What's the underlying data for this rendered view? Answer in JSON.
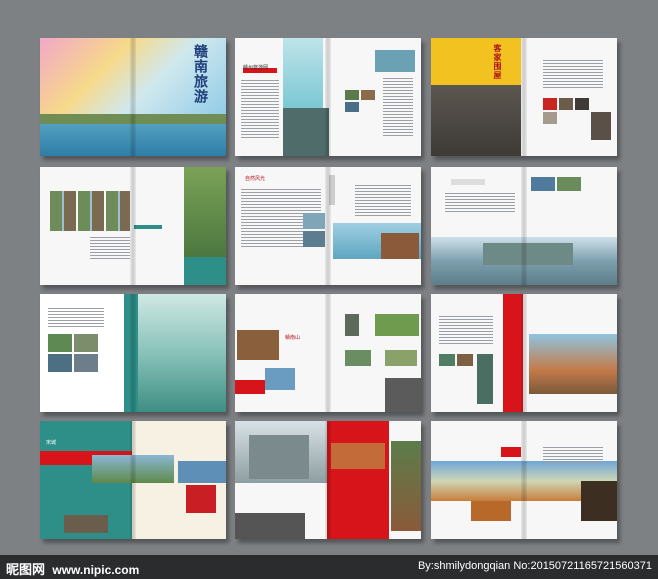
{
  "cover": {
    "title": "赣南旅游"
  },
  "spreads": {
    "s2": {
      "heading": "赣州旅游网"
    },
    "s3": {
      "heading": "客家围屋"
    },
    "s5": {
      "heading": "自然风光"
    },
    "s8": {
      "heading": "赣南山"
    },
    "s10": {
      "heading": "宋城"
    }
  },
  "watermark": {
    "logo": "昵图网",
    "url": "www.nipic.com",
    "credit": "By:shmilydongqian No:20150721165721560371"
  },
  "colors": {
    "red": "#d7141a",
    "teal": "#2e8f88",
    "sky": "#57b7cf",
    "cream": "#f6f1e2"
  }
}
